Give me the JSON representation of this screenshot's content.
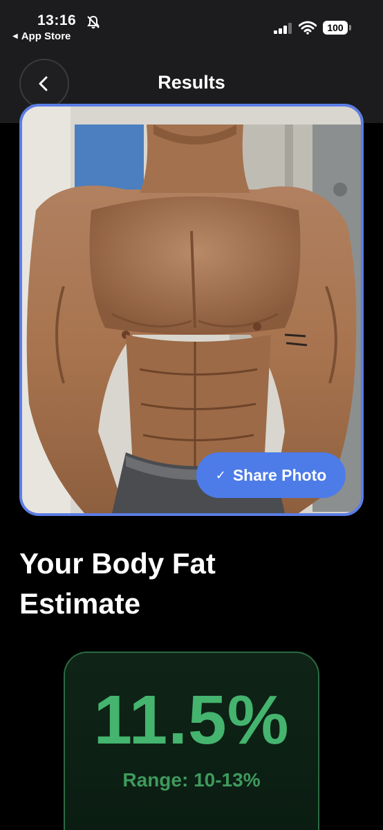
{
  "status_bar": {
    "time": "13:16",
    "back_app": "App Store",
    "battery": "100"
  },
  "nav": {
    "title": "Results"
  },
  "photo": {
    "share_label": "Share Photo",
    "accent": "#5b7de6"
  },
  "result": {
    "heading": "Your Body Fat Estimate",
    "value": "11.5%",
    "range": "Range: 10-13%",
    "accent": "#44b46e"
  }
}
